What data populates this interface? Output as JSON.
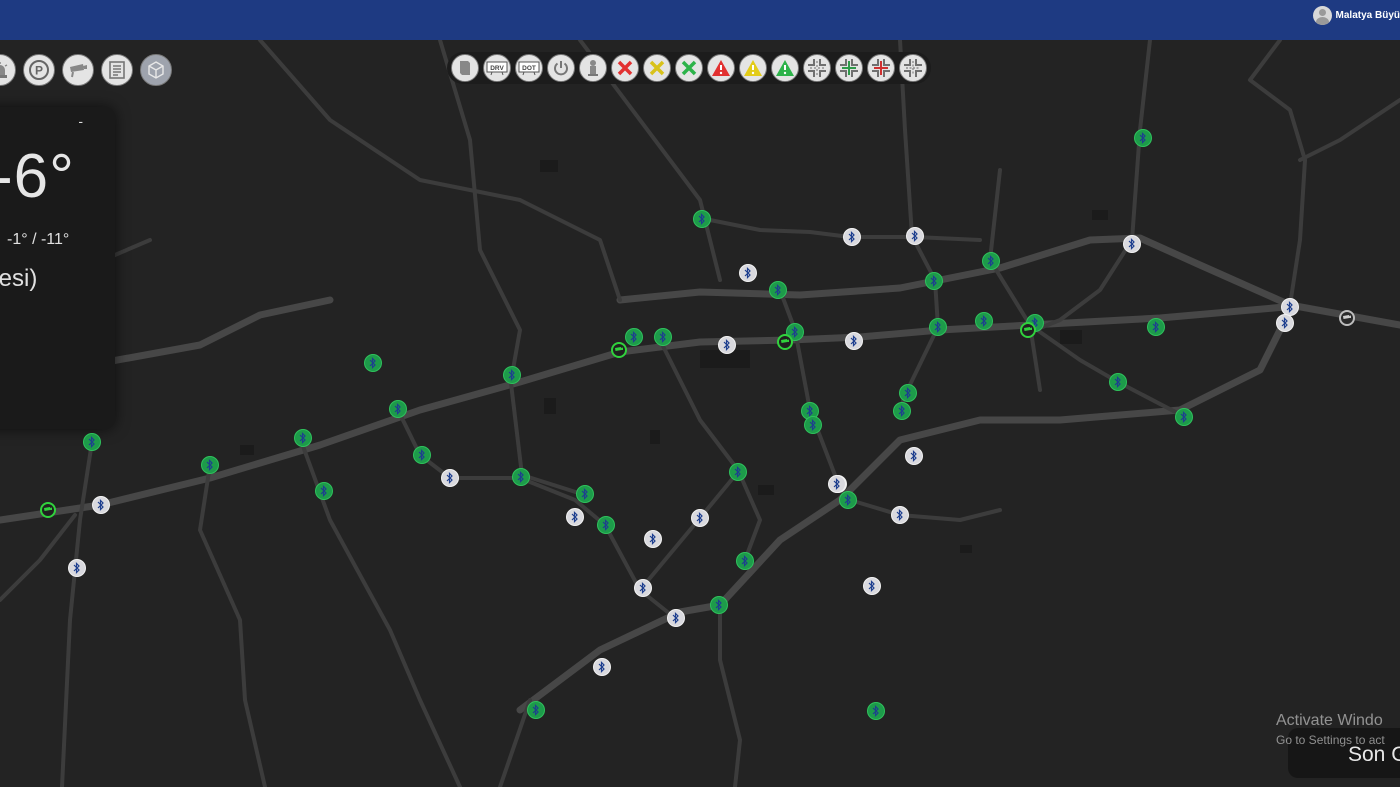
{
  "header": {
    "user_name": "Malatya Büyü"
  },
  "toolbar_center": [
    {
      "icon": "document-icon",
      "label": ""
    },
    {
      "icon": "drv-icon",
      "label": "DRV"
    },
    {
      "icon": "dot-icon",
      "label": "DOT"
    },
    {
      "icon": "power-icon",
      "label": ""
    },
    {
      "icon": "hydrant-icon",
      "label": ""
    },
    {
      "icon": "red-x-icon",
      "color": "#e23030"
    },
    {
      "icon": "yellow-x-icon",
      "color": "#d8c21a"
    },
    {
      "icon": "green-x-icon",
      "color": "#2db34a"
    },
    {
      "icon": "red-warning-icon",
      "color": "#e23030"
    },
    {
      "icon": "yellow-warning-icon",
      "color": "#e3cc18"
    },
    {
      "icon": "green-warning-icon",
      "color": "#2db34a"
    },
    {
      "icon": "intersection-grey-icon",
      "color": "#707070"
    },
    {
      "icon": "intersection-green-icon",
      "color": "#2e9b4a"
    },
    {
      "icon": "intersection-red-icon",
      "color": "#d03030"
    },
    {
      "icon": "intersection-white-icon",
      "color": "#909090"
    }
  ],
  "toolbar_left": [
    {
      "icon": "siren-icon"
    },
    {
      "icon": "parking-icon",
      "label": "P"
    },
    {
      "icon": "camera-icon"
    },
    {
      "icon": "news-icon"
    },
    {
      "icon": "cube-icon"
    }
  ],
  "weather": {
    "dash": "-",
    "temperature": "-6°",
    "range": "-1° / -11°",
    "day": "tesi)"
  },
  "marker_colors": {
    "green": "#1d9b4a",
    "white": "#d9d9de",
    "bluetooth": "#1e3f8f",
    "camera": "#31d23d"
  },
  "map_markers": [
    {
      "type": "green"
    },
    {
      "type": "green"
    },
    {
      "type": "white"
    },
    {
      "type": "white"
    },
    {
      "type": "white"
    },
    {
      "type": "green"
    },
    {
      "type": "white"
    },
    {
      "type": "green"
    },
    {
      "type": "green"
    },
    {
      "type": "white"
    },
    {
      "type": "white"
    },
    {
      "type": "green"
    },
    {
      "type": "green"
    },
    {
      "type": "green"
    },
    {
      "type": "green"
    },
    {
      "type": "green"
    },
    {
      "type": "green"
    },
    {
      "type": "white"
    },
    {
      "type": "white"
    },
    {
      "type": "green"
    },
    {
      "type": "green"
    },
    {
      "type": "green"
    },
    {
      "type": "green"
    },
    {
      "type": "green"
    },
    {
      "type": "green"
    },
    {
      "type": "green"
    },
    {
      "type": "green"
    },
    {
      "type": "green"
    },
    {
      "type": "green"
    },
    {
      "type": "white"
    },
    {
      "type": "green"
    },
    {
      "type": "white"
    },
    {
      "type": "green"
    },
    {
      "type": "green"
    },
    {
      "type": "white"
    },
    {
      "type": "green"
    },
    {
      "type": "white"
    },
    {
      "type": "green"
    },
    {
      "type": "green"
    },
    {
      "type": "white"
    },
    {
      "type": "white"
    },
    {
      "type": "white"
    },
    {
      "type": "white"
    },
    {
      "type": "white"
    },
    {
      "type": "green"
    },
    {
      "type": "green"
    },
    {
      "type": "white"
    },
    {
      "type": "green"
    },
    {
      "type": "white"
    },
    {
      "type": "green"
    },
    {
      "type": "green"
    },
    {
      "type": "green"
    },
    {
      "type": "white"
    },
    {
      "type": "white"
    },
    {
      "type": "white"
    },
    {
      "type": "green"
    },
    {
      "type": "green"
    }
  ],
  "camera_markers": [
    {
      "type": "green"
    },
    {
      "type": "green"
    },
    {
      "type": "green"
    },
    {
      "type": "green"
    },
    {
      "type": "grey"
    }
  ],
  "watermark": {
    "title": "Activate Windo",
    "subtitle": "Go to Settings to act"
  },
  "bottom_panel": {
    "label": "Son G"
  }
}
